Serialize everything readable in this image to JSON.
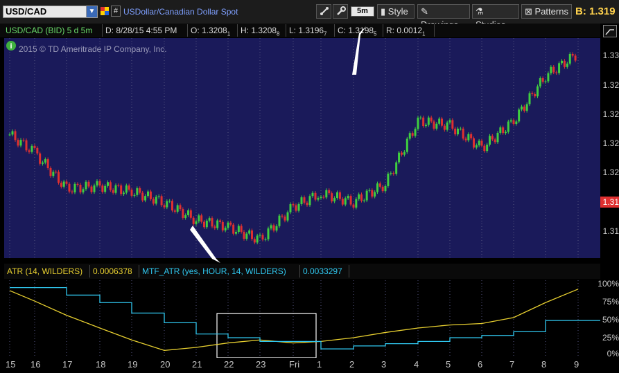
{
  "toolbar": {
    "symbol": "USD/CAD",
    "description": "USDollar/Canadian Dollar Spot",
    "hash_label": "#",
    "timeframe": "5m",
    "style_label": "Style",
    "drawings_label": "Drawings",
    "studies_label": "Studies",
    "patterns_label": "Patterns",
    "bid": "B: 1.319"
  },
  "infobar": {
    "symbol_period": "USD/CAD (BID) 5 d 5m",
    "date": "D: 8/28/15 4:55 PM",
    "open": "O: 1.3208",
    "open_sup": "1",
    "high": "H: 1.3208",
    "high_sup": "8",
    "low": "L: 1.3196",
    "low_sup": "7",
    "close": "C: 1.3198",
    "close_sup": "5",
    "range": "R: 0.0012",
    "range_sup": "1"
  },
  "copyright": "2015 © TD Ameritrade IP Company, Inc.",
  "price_axis": {
    "labels": [
      "1.33",
      "1.32",
      "1.32",
      "1.32",
      "1.32",
      "1.31",
      "1.31"
    ],
    "current_price_tag": "1.31"
  },
  "indicator": {
    "atr_label": "ATR (14, WILDERS)",
    "atr_value": "0.0006378",
    "mtf_label": "MTF_ATR (yes, HOUR, 14, WILDERS)",
    "mtf_value": "0.0033297",
    "pct_labels": [
      "100%",
      "75%",
      "50%",
      "25%",
      "0%"
    ]
  },
  "x_axis": {
    "labels": [
      "15",
      "16",
      "17",
      "18",
      "19",
      "20",
      "21",
      "22",
      "23",
      "Fri",
      "1",
      "2",
      "3",
      "4",
      "5",
      "6",
      "7",
      "8",
      "9"
    ]
  },
  "colors": {
    "chart_bg": "#1a1a5a",
    "up_candle": "#3fcf3f",
    "down_candle": "#e03030",
    "atr_line": "#e8d030",
    "mtf_line": "#30c8f0",
    "bid_text": "#ffd24d",
    "price_tag": "#e03030"
  },
  "chart_data": {
    "type": "line",
    "price_series": {
      "name": "USD/CAD",
      "x": [
        "15",
        "16",
        "17",
        "18",
        "19",
        "20",
        "21",
        "22",
        "23",
        "Fri",
        "1",
        "2",
        "3",
        "4",
        "5",
        "6",
        "7",
        "8",
        "9"
      ],
      "close": [
        1.3245,
        1.3225,
        1.3185,
        1.3188,
        1.3182,
        1.317,
        1.315,
        1.3143,
        1.3128,
        1.3165,
        1.318,
        1.317,
        1.319,
        1.326,
        1.3255,
        1.323,
        1.326,
        1.331,
        1.3335
      ]
    },
    "ind_series": [
      {
        "name": "ATR (14, WILDERS)",
        "values": [
          88,
          74,
          55,
          38,
          22,
          8,
          12,
          18,
          22,
          18,
          20,
          25,
          32,
          38,
          42,
          44,
          52,
          72,
          90
        ]
      },
      {
        "name": "MTF_ATR (yes, HOUR, 14, WILDERS)",
        "values": [
          92,
          92,
          82,
          72,
          58,
          45,
          30,
          25,
          20,
          20,
          10,
          14,
          17,
          20,
          25,
          28,
          33,
          48,
          48
        ]
      }
    ],
    "ind_ylim": [
      0,
      100
    ]
  }
}
